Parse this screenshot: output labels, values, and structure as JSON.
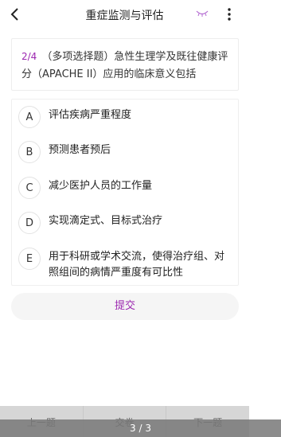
{
  "header": {
    "title": "重症监测与评估",
    "back_icon": "chevron-left-icon",
    "eye_icon": "eye-closed-icon",
    "more_icon": "more-vertical-icon"
  },
  "question": {
    "number": "2/4",
    "text": "（多项选择题）急性生理学及既往健康评分（APACHE II）应用的临床意义包括"
  },
  "options": [
    {
      "letter": "A",
      "text": "评估疾病严重程度"
    },
    {
      "letter": "B",
      "text": "预测患者预后"
    },
    {
      "letter": "C",
      "text": "减少医护人员的工作量"
    },
    {
      "letter": "D",
      "text": "实现滴定式、目标式治疗"
    },
    {
      "letter": "E",
      "text": "用于科研或学术交流，使得治疗组、对照组间的病情严重度有可比性"
    }
  ],
  "submit_label": "提交",
  "footer": {
    "prev_label": "上一题",
    "submit_label": "交卷",
    "next_label": "下一题"
  },
  "toast": "3 / 3",
  "colors": {
    "accent": "#9c27b0",
    "background": "#f6f6f6"
  }
}
